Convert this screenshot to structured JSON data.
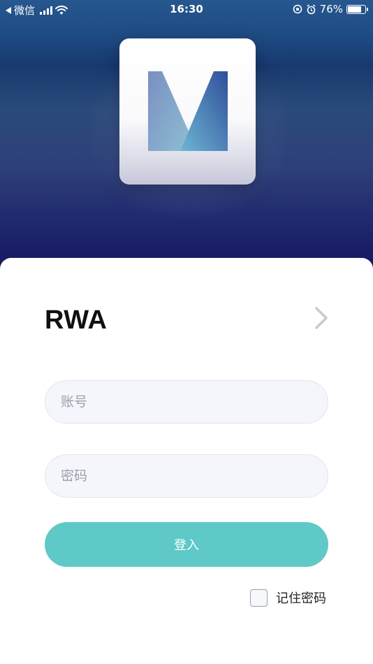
{
  "status_bar": {
    "back_app": "微信",
    "time": "16:30",
    "battery_percent": "76%",
    "battery_level": 0.76
  },
  "brand": {
    "name": "RWA"
  },
  "form": {
    "account_placeholder": "账号",
    "password_placeholder": "密码",
    "login_label": "登入",
    "remember_label": "记住密码",
    "remember_checked": false
  },
  "colors": {
    "accent": "#5ec9c6",
    "hero_top": "#27578f",
    "hero_bottom": "#161a63"
  }
}
